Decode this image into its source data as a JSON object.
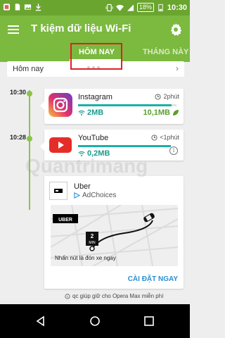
{
  "statusbar": {
    "battery_percent": "18%",
    "time": "10:30",
    "icons": [
      "app-icon",
      "sd-card-icon",
      "image-icon",
      "download-icon",
      "vibrate-icon",
      "wifi-icon",
      "signal-icon",
      "battery-icon"
    ]
  },
  "appbar": {
    "title": "T kiệm dữ liệu Wi-Fi",
    "menu_icon": "hamburger-menu-icon",
    "settings_icon": "gear-icon"
  },
  "tabs": [
    {
      "label": "HÔM NAY",
      "active": true
    },
    {
      "label": "THÁNG NÀY",
      "active": false
    }
  ],
  "date_row": {
    "label": "Hôm nay",
    "chevron": "›"
  },
  "timeline": {
    "times": [
      "10:30",
      "10:28"
    ]
  },
  "apps": [
    {
      "name": "Instagram",
      "duration": "2phút",
      "wifi": "2MB",
      "saved": "10,1MB",
      "bar_fraction": 0.95
    },
    {
      "name": "YouTube",
      "duration": "<1phút",
      "wifi": "0,2MB",
      "bar_fraction": 1.0
    }
  ],
  "ad": {
    "brand": "Uber",
    "adchoices": "AdChoices",
    "logo_text": "UBER",
    "eta_number": "2",
    "eta_unit": "MIN",
    "map_caption": "Nhấn nút là đón xe ngay",
    "cta": "CÀI ĐẶT NGAY"
  },
  "footer_note": "qc giúp giữ cho Opera Max miễn phí",
  "watermark": "Quantrimang",
  "colors": {
    "statusbar": "#6aa52f",
    "appbar": "#7bb93f",
    "accent_teal": "#1a9b8e",
    "accent_green": "#5aa02c",
    "highlight_red": "#e01f26",
    "cta_blue": "#2a8fd1"
  }
}
